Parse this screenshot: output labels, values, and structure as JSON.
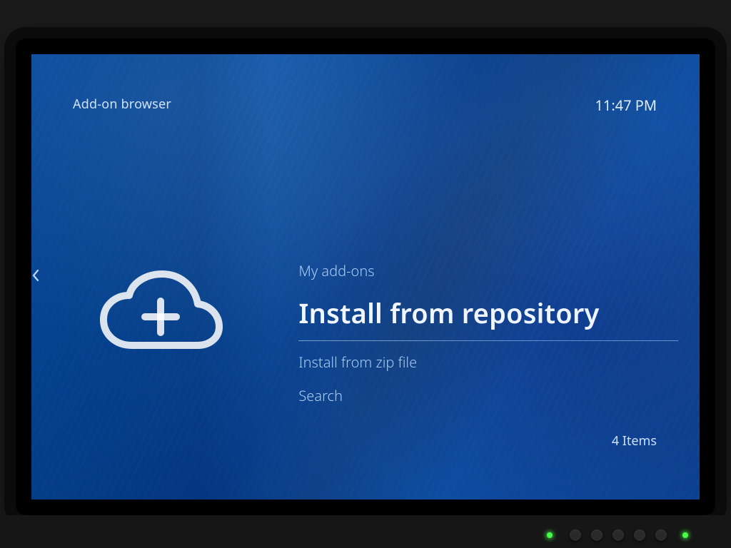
{
  "header": {
    "title": "Add-on browser",
    "clock": "11:47 PM"
  },
  "sidebar": {
    "icon": "cloud-plus-icon"
  },
  "menu": {
    "items": [
      {
        "label": "My add-ons",
        "selected": false
      },
      {
        "label": "Install from repository",
        "selected": true
      },
      {
        "label": "Install from zip file",
        "selected": false
      },
      {
        "label": "Search",
        "selected": false
      }
    ]
  },
  "footer": {
    "items_count_label": "4 Items"
  }
}
